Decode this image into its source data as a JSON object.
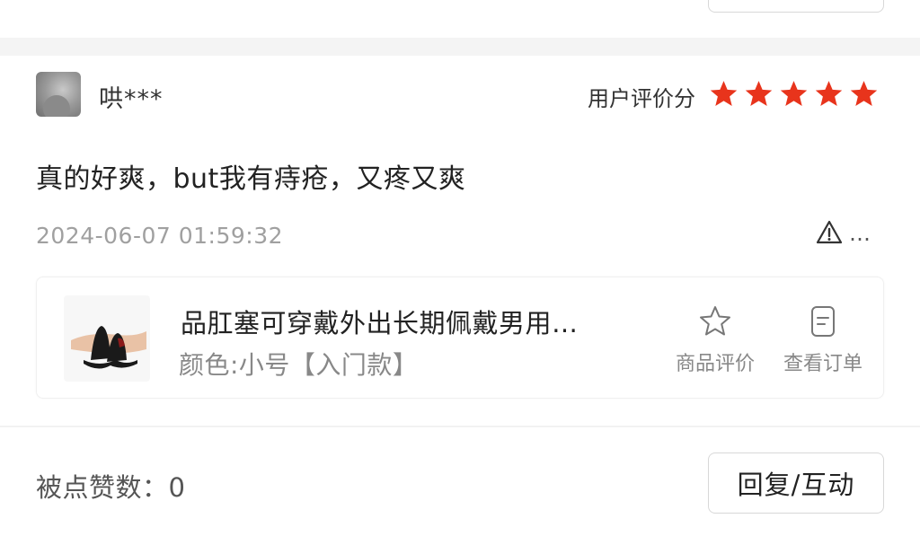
{
  "review": {
    "username": "哄***",
    "rating_label": "用户评价分",
    "rating": 5,
    "rating_max": 5,
    "star_color": "#e8341c",
    "text": "真的好爽，but我有痔疮，又疼又爽",
    "timestamp": "2024-06-07 01:59:32",
    "more": "…"
  },
  "product": {
    "title": "品肛塞可穿戴外出长期佩戴男用…",
    "variant": "颜色:小号【入门款】",
    "actions": {
      "product_review": "商品评价",
      "view_order": "查看订单"
    }
  },
  "footer": {
    "likes_label": "被点赞数：",
    "likes_count": "0",
    "reply_label": "回复/互动"
  },
  "icons": {
    "report": "warning-triangle-icon",
    "more": "more-dots-icon",
    "product_review": "star-outline-icon",
    "view_order": "document-icon"
  }
}
